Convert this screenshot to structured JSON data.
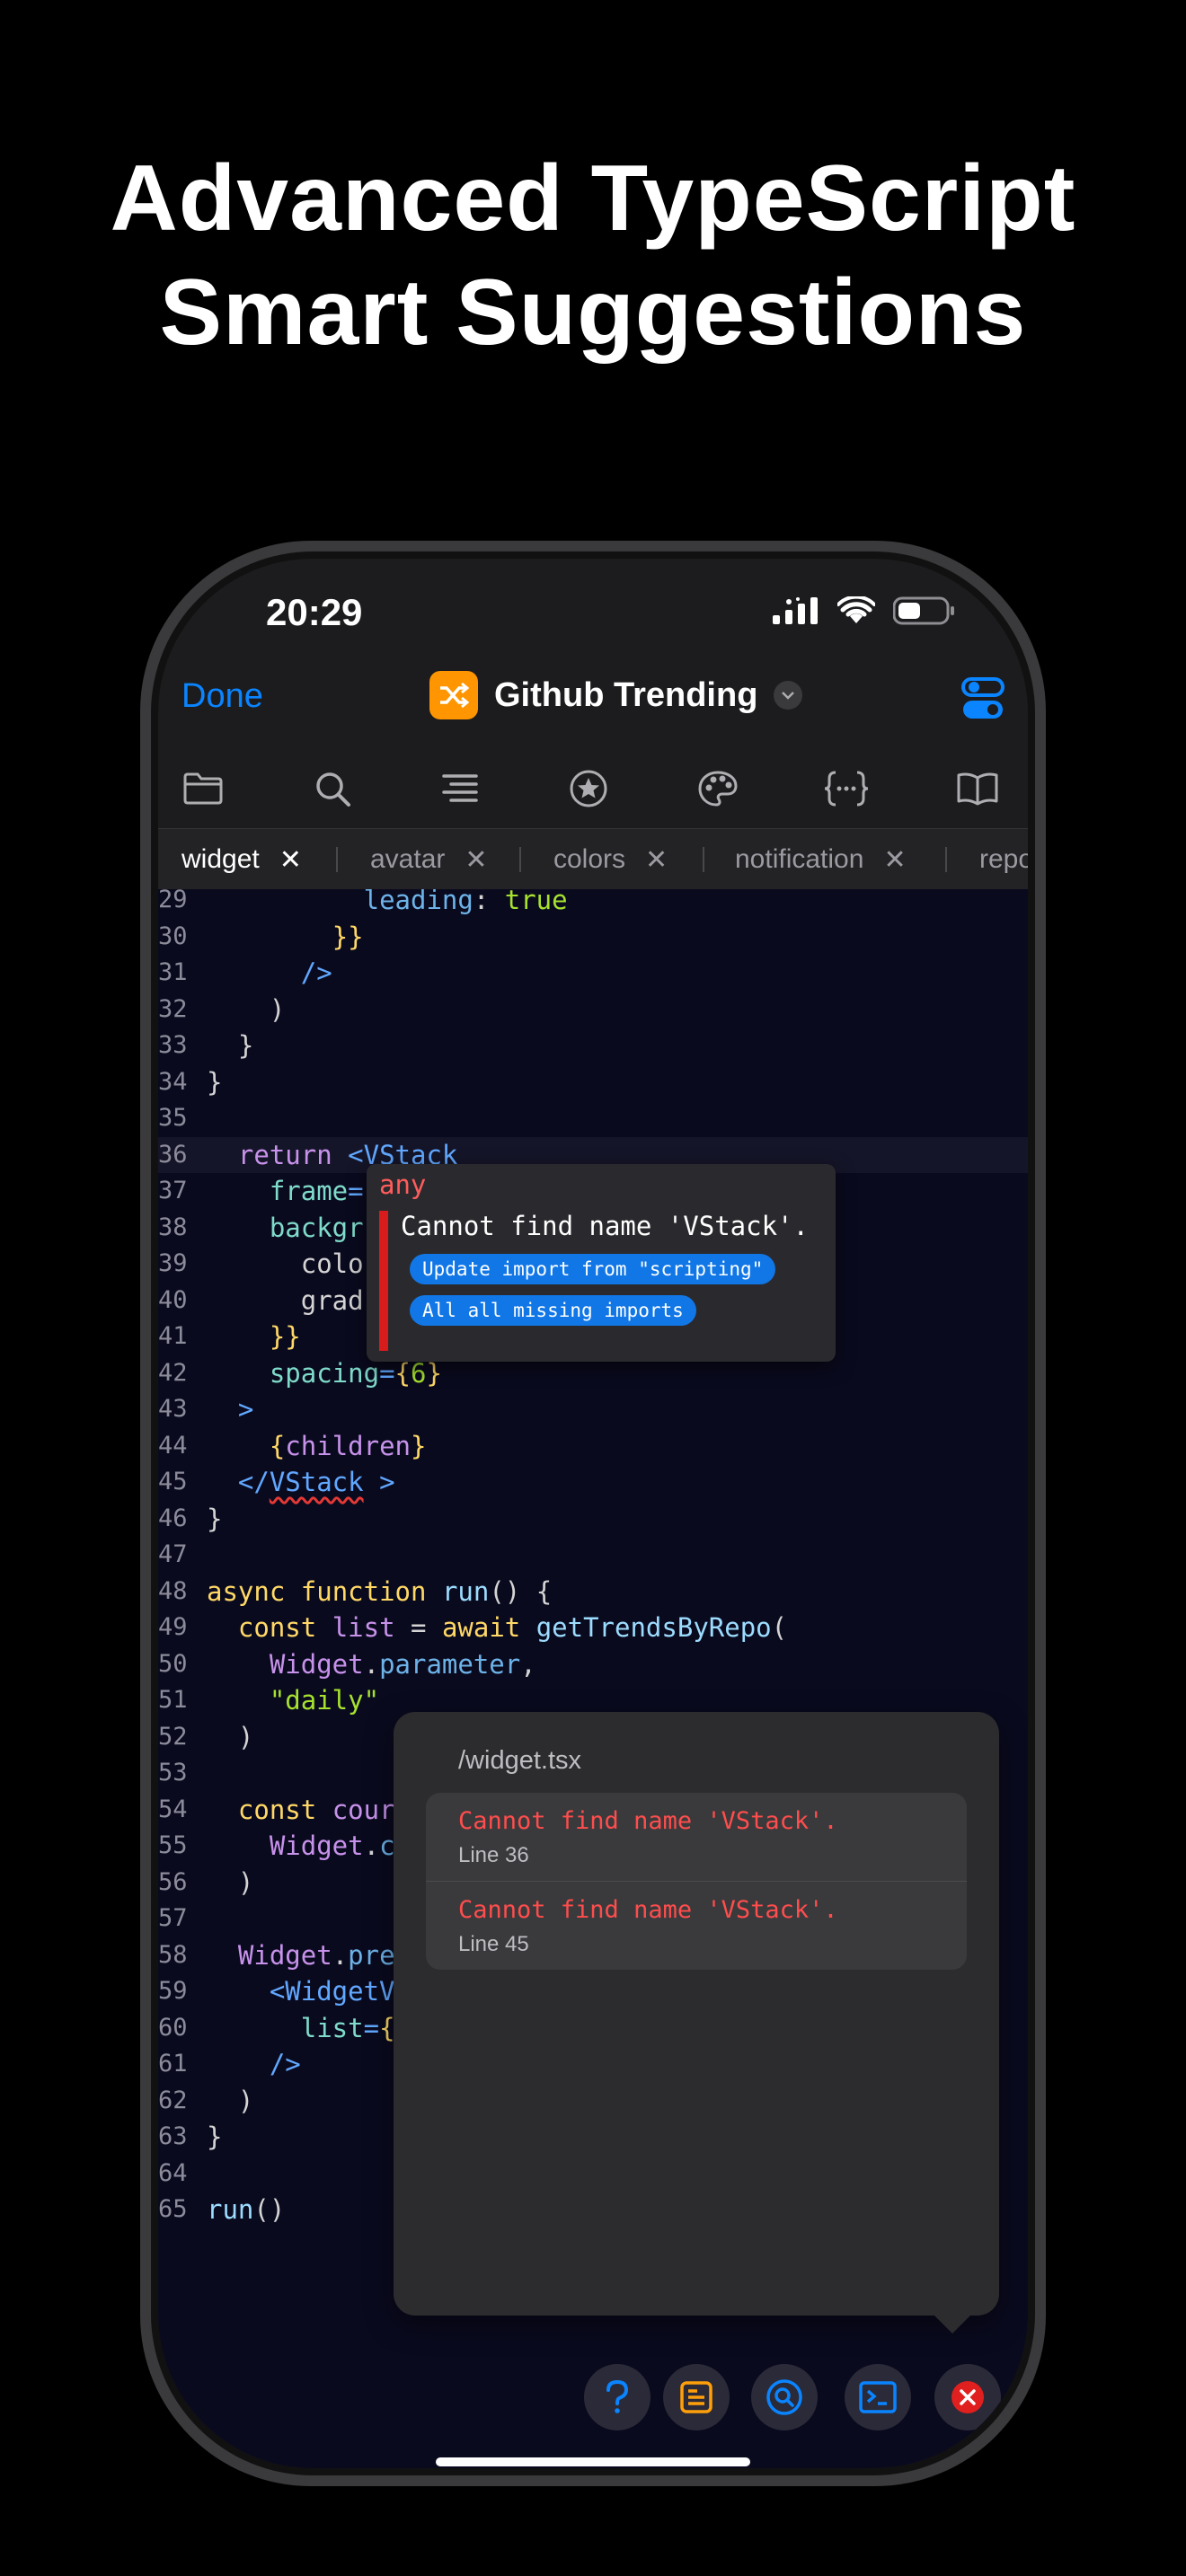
{
  "headline": {
    "line1": "Advanced TypeScript",
    "line2": "Smart Suggestions"
  },
  "status_bar": {
    "time": "20:29"
  },
  "nav": {
    "done": "Done",
    "title": "Github Trending"
  },
  "toolbar": {
    "icons": [
      "folder-icon",
      "search-icon",
      "outline-icon",
      "favorites-icon",
      "theme-palette-icon",
      "json-braces-icon",
      "docs-book-icon"
    ]
  },
  "tabs": [
    {
      "label": "widget",
      "active": true
    },
    {
      "label": "avatar",
      "active": false
    },
    {
      "label": "colors",
      "active": false
    },
    {
      "label": "notification",
      "active": false
    },
    {
      "label": "repo",
      "active": false
    }
  ],
  "code": {
    "lines": [
      {
        "n": "29",
        "tokens": [
          [
            "          ",
            "plain"
          ],
          [
            "leading",
            "prop"
          ],
          [
            ": ",
            "plain"
          ],
          [
            "true",
            "str"
          ]
        ]
      },
      {
        "n": "30",
        "tokens": [
          [
            "        ",
            "plain"
          ],
          [
            "}}",
            "brace"
          ]
        ]
      },
      {
        "n": "31",
        "tokens": [
          [
            "      ",
            "plain"
          ],
          [
            "/>",
            "tag"
          ]
        ]
      },
      {
        "n": "32",
        "tokens": [
          [
            "    ",
            "plain"
          ],
          [
            ")",
            "plain"
          ]
        ]
      },
      {
        "n": "33",
        "tokens": [
          [
            "  ",
            "plain"
          ],
          [
            "}",
            "plain"
          ]
        ]
      },
      {
        "n": "34",
        "tokens": [
          [
            "}",
            "plain"
          ]
        ]
      },
      {
        "n": "35",
        "tokens": []
      },
      {
        "n": "36",
        "tokens": [
          [
            "  ",
            "plain"
          ],
          [
            "return",
            "kw"
          ],
          [
            " ",
            "plain"
          ],
          [
            "<VStack",
            "tag"
          ]
        ]
      },
      {
        "n": "37",
        "tokens": [
          [
            "    ",
            "plain"
          ],
          [
            "frame",
            "attr"
          ],
          [
            "=",
            "tag"
          ]
        ]
      },
      {
        "n": "38",
        "tokens": [
          [
            "    ",
            "plain"
          ],
          [
            "backgr",
            "attr"
          ]
        ]
      },
      {
        "n": "39",
        "tokens": [
          [
            "      ",
            "plain"
          ],
          [
            "colo",
            "plain"
          ]
        ]
      },
      {
        "n": "40",
        "tokens": [
          [
            "      ",
            "plain"
          ],
          [
            "grad",
            "plain"
          ]
        ]
      },
      {
        "n": "41",
        "tokens": [
          [
            "    ",
            "plain"
          ],
          [
            "}}",
            "brace"
          ]
        ]
      },
      {
        "n": "42",
        "tokens": [
          [
            "    ",
            "plain"
          ],
          [
            "spacing",
            "attr"
          ],
          [
            "=",
            "tag"
          ],
          [
            "{",
            "brace"
          ],
          [
            "6",
            "str"
          ],
          [
            "}",
            "brace"
          ]
        ]
      },
      {
        "n": "43",
        "tokens": [
          [
            "  ",
            "plain"
          ],
          [
            ">",
            "tag"
          ]
        ]
      },
      {
        "n": "44",
        "tokens": [
          [
            "    ",
            "plain"
          ],
          [
            "{",
            "brace"
          ],
          [
            "children",
            "kw"
          ],
          [
            "}",
            "brace"
          ]
        ]
      },
      {
        "n": "45",
        "tokens": [
          [
            "  ",
            "plain"
          ],
          [
            "</",
            "tag"
          ],
          [
            "VStack",
            "tag-err"
          ],
          [
            " >",
            "tag"
          ]
        ]
      },
      {
        "n": "46",
        "tokens": [
          [
            "}",
            "plain"
          ]
        ]
      },
      {
        "n": "47",
        "tokens": []
      },
      {
        "n": "48",
        "tokens": [
          [
            "async",
            "fn"
          ],
          [
            " ",
            "plain"
          ],
          [
            "function",
            "fn"
          ],
          [
            " ",
            "plain"
          ],
          [
            "run",
            "var"
          ],
          [
            "() {",
            "plain"
          ]
        ]
      },
      {
        "n": "49",
        "tokens": [
          [
            "  ",
            "plain"
          ],
          [
            "const",
            "fn"
          ],
          [
            " ",
            "plain"
          ],
          [
            "list",
            "kw"
          ],
          [
            " = ",
            "plain"
          ],
          [
            "await",
            "fn"
          ],
          [
            " ",
            "plain"
          ],
          [
            "getTrendsByRepo",
            "var"
          ],
          [
            "(",
            "plain"
          ]
        ]
      },
      {
        "n": "50",
        "tokens": [
          [
            "    ",
            "plain"
          ],
          [
            "Widget",
            "kw"
          ],
          [
            ".",
            "plain"
          ],
          [
            "parameter",
            "prop"
          ],
          [
            ",",
            "plain"
          ]
        ]
      },
      {
        "n": "51",
        "tokens": [
          [
            "    ",
            "plain"
          ],
          [
            "\"daily\"",
            "str"
          ]
        ]
      },
      {
        "n": "52",
        "tokens": [
          [
            "  ",
            "plain"
          ],
          [
            ")",
            "plain"
          ]
        ]
      },
      {
        "n": "53",
        "tokens": []
      },
      {
        "n": "54",
        "tokens": [
          [
            "  ",
            "plain"
          ],
          [
            "const",
            "fn"
          ],
          [
            " ",
            "plain"
          ],
          [
            "cour",
            "kw"
          ]
        ]
      },
      {
        "n": "55",
        "tokens": [
          [
            "    ",
            "plain"
          ],
          [
            "Widget",
            "kw"
          ],
          [
            ".",
            "plain"
          ],
          [
            "c",
            "prop"
          ]
        ]
      },
      {
        "n": "56",
        "tokens": [
          [
            "  ",
            "plain"
          ],
          [
            ")",
            "plain"
          ]
        ]
      },
      {
        "n": "57",
        "tokens": []
      },
      {
        "n": "58",
        "tokens": [
          [
            "  ",
            "plain"
          ],
          [
            "Widget",
            "kw"
          ],
          [
            ".",
            "plain"
          ],
          [
            "pre",
            "prop"
          ]
        ]
      },
      {
        "n": "59",
        "tokens": [
          [
            "    ",
            "plain"
          ],
          [
            "<WidgetV",
            "tag"
          ]
        ]
      },
      {
        "n": "60",
        "tokens": [
          [
            "      ",
            "plain"
          ],
          [
            "list",
            "attr"
          ],
          [
            "=",
            "tag"
          ],
          [
            "{",
            "brace"
          ]
        ]
      },
      {
        "n": "61",
        "tokens": [
          [
            "    ",
            "plain"
          ],
          [
            "/>",
            "tag"
          ]
        ]
      },
      {
        "n": "62",
        "tokens": [
          [
            "  ",
            "plain"
          ],
          [
            ")",
            "plain"
          ]
        ]
      },
      {
        "n": "63",
        "tokens": [
          [
            "}",
            "plain"
          ]
        ]
      },
      {
        "n": "64",
        "tokens": []
      },
      {
        "n": "65",
        "tokens": [
          [
            "run",
            "var"
          ],
          [
            "()",
            "plain"
          ]
        ]
      }
    ],
    "highlighted_line": "36"
  },
  "hover": {
    "type": "any",
    "message": "Cannot find name 'VStack'.",
    "actions": [
      "Update import from \"scripting\"",
      "All all missing imports"
    ]
  },
  "problems": {
    "file": "/widget.tsx",
    "items": [
      {
        "message": "Cannot find name 'VStack'.",
        "line": "Line 36"
      },
      {
        "message": "Cannot find name 'VStack'.",
        "line": "Line 45"
      }
    ]
  },
  "bottom_buttons": [
    "help-icon",
    "console-icon",
    "search-icon",
    "terminal-icon",
    "errors-icon"
  ],
  "colors": {
    "accent": "#0a84ff",
    "error": "#ff4d4d",
    "editor_bg": "#0a0a1f",
    "app_icon": "#ff9500"
  }
}
